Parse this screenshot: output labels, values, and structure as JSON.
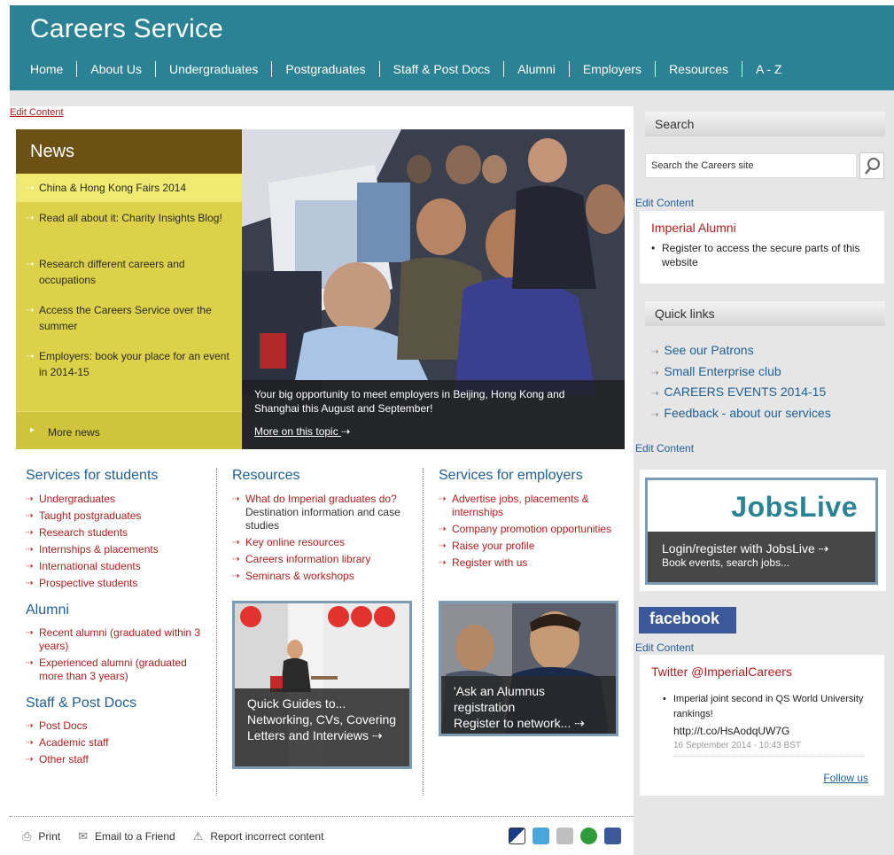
{
  "header": {
    "title": "Careers Service",
    "nav": [
      "Home",
      "About Us",
      "Undergraduates",
      "Postgraduates",
      "Staff & Post Docs",
      "Alumni",
      "Employers",
      "Resources",
      "A - Z"
    ]
  },
  "edit_content_label": "Edit Content",
  "news": {
    "heading": "News",
    "items": [
      "China & Hong Kong Fairs 2014",
      "Read all about it: Charity Insights Blog!",
      "Research different careers and occupations",
      "Access the Careers Service over the summer",
      "Employers: book your place for an event in 2014-15"
    ],
    "more": "More news"
  },
  "hero": {
    "caption": "Your big opportunity to meet employers in Beijing, Hong Kong and Shanghai this August and September!",
    "more": "More on this topic",
    "more_arrow": "⇢"
  },
  "students": {
    "title": "Services for students",
    "links": [
      "Undergraduates",
      "Taught postgraduates",
      "Research students",
      "Internships & placements",
      "International students",
      "Prospective students"
    ],
    "alumni_title": "Alumni",
    "alumni_links": [
      "Recent alumni (graduated within 3 years)",
      "Experienced alumni (graduated more than 3 years)"
    ],
    "staff_title": "Staff & Post Docs",
    "staff_links": [
      "Post Docs",
      "Academic staff",
      "Other staff"
    ]
  },
  "resources": {
    "title": "Resources",
    "link1": "What do Imperial graduates do?",
    "link1_sub": "Destination information and case studies",
    "links": [
      "Key online resources",
      "Careers information library",
      "Seminars & workshops"
    ],
    "promo": "Quick Guides to... Networking, CVs, Covering Letters and Interviews ⇢"
  },
  "employers": {
    "title": "Services for employers",
    "links": [
      "Advertise jobs, placements & internships",
      "Company promotion opportunities",
      "Raise your profile",
      "Register with us"
    ],
    "promo_line1": "'Ask an Alumnus registration",
    "promo_line2": "Register to network... ⇢"
  },
  "footer": {
    "print": "Print",
    "email": "Email to a Friend",
    "report": "Report incorrect content"
  },
  "sidebar": {
    "search_title": "Search",
    "search_placeholder": "Search the Careers site",
    "alumni_title": "Imperial Alumni",
    "alumni_item": "Register to access the secure parts of this website",
    "quicklinks_title": "Quick links",
    "quicklinks": [
      "See our Patrons",
      "Small Enterprise club",
      "CAREERS EVENTS 2014-15",
      "Feedback  - about our services"
    ],
    "jobslive_logo": "JobsLive",
    "jobslive_title": "Login/register with JobsLive ⇢",
    "jobslive_sub": "Book events, search jobs...",
    "facebook": "facebook",
    "twitter_title": "Twitter @ImperialCareers",
    "tweet_text": "Imperial joint second in QS World University rankings!",
    "tweet_link": "http://t.co/HsAodqUW7G",
    "tweet_time": "16 September 2014 - 10:43 BST",
    "follow": "Follow us"
  },
  "colors": {
    "header": "#2b8294",
    "news_bg": "#ddd14a",
    "news_head": "#6b5214",
    "link_red": "#b01e1e",
    "link_blue": "#1f5f94"
  }
}
